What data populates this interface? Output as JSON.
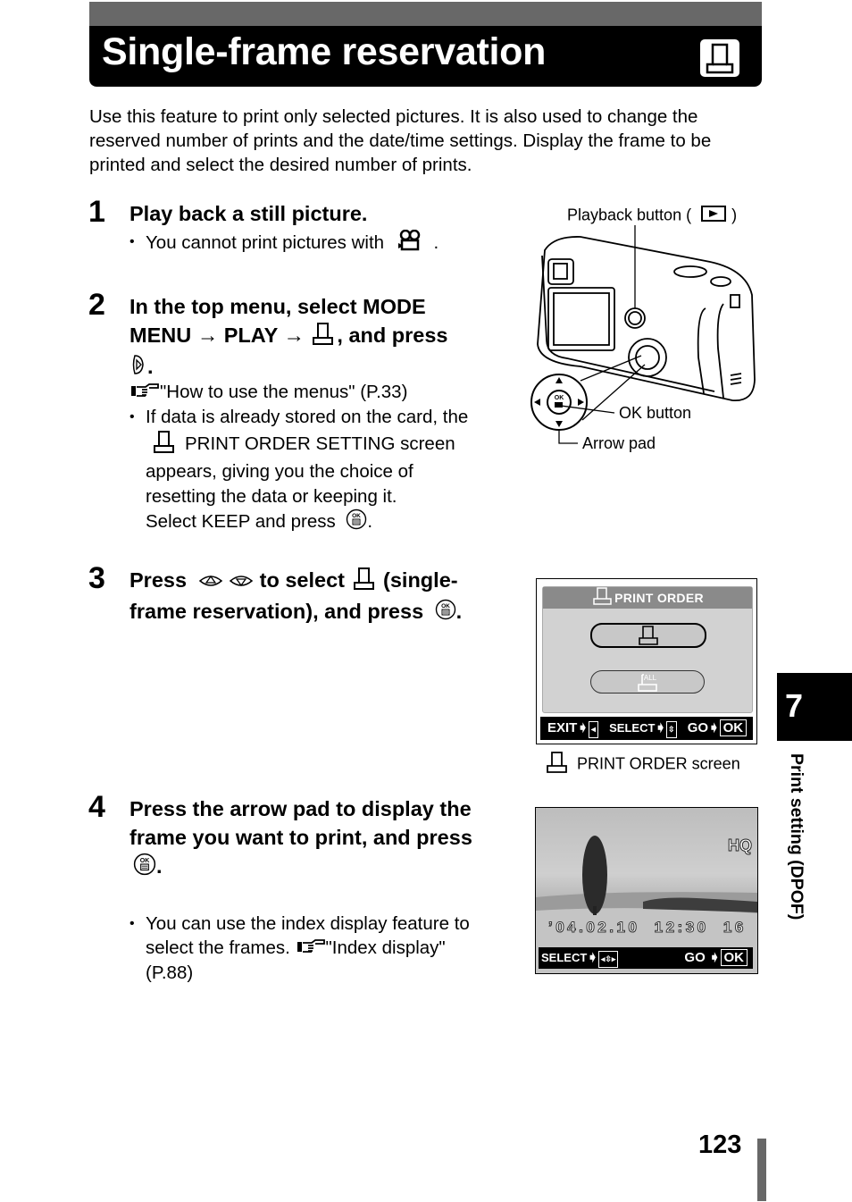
{
  "header": {
    "title": "Single-frame reservation",
    "icon": "print-reservation-icon"
  },
  "intro": "Use this feature to print only selected pictures. It is also used to change the reserved number of prints and the date/time settings. Display the frame to be printed and select the desired number of prints.",
  "steps": [
    {
      "number": "1",
      "title": "Play back a still picture.",
      "bullets": [
        {
          "text_before": "You cannot print pictures with",
          "icon": "movie-icon",
          "text_after": "."
        }
      ]
    },
    {
      "number": "2",
      "title_line1": "In the top menu, select MODE",
      "title_line2_a": "MENU",
      "title_line2_b": "PLAY",
      "title_line2_c": ", and press",
      "arrow": "→",
      "title_line3": ".",
      "ref": "\"How to use the menus\" (P.33)",
      "bullet_lines": [
        "If data is already stored on the card, the",
        "PRINT ORDER SETTING screen",
        "appears, giving you the choice of",
        "resetting the data or keeping it.",
        "Select KEEP and press"
      ],
      "bullet_end": "."
    },
    {
      "number": "3",
      "title_a": "Press",
      "title_b": "to select",
      "title_c": "(single-",
      "title_line2": "frame reservation), and press",
      "title_end": "."
    },
    {
      "number": "4",
      "title_line1": "Press the arrow pad to display the",
      "title_line2": "frame you want to print, and press",
      "title_line3": ".",
      "bullet_line1": "You can use the index display feature to",
      "bullet_line2_a": "select the frames.",
      "bullet_line2_b": "\"Index display\"",
      "bullet_line3": "(P.88)"
    }
  ],
  "camera_figure": {
    "playback_label_a": "Playback button (",
    "playback_label_b": ")",
    "ok_label": "OK button",
    "arrow_label": "Arrow pad",
    "ok_text": "OK"
  },
  "print_order_screen": {
    "header": "PRINT ORDER",
    "option_all_text": "ALL",
    "footer_exit": "EXIT",
    "footer_select": "SELECT",
    "footer_go": "GO",
    "footer_ok": "OK",
    "caption": "PRINT ORDER screen"
  },
  "photo_screen": {
    "quality": "HQ",
    "date": "’04.02.10",
    "time": "12:30",
    "frame": "16",
    "footer_select": "SELECT",
    "footer_go": "GO",
    "footer_ok": "OK"
  },
  "chapter": {
    "number": "7",
    "label": "Print setting (DPOF)"
  },
  "page_number": "123"
}
